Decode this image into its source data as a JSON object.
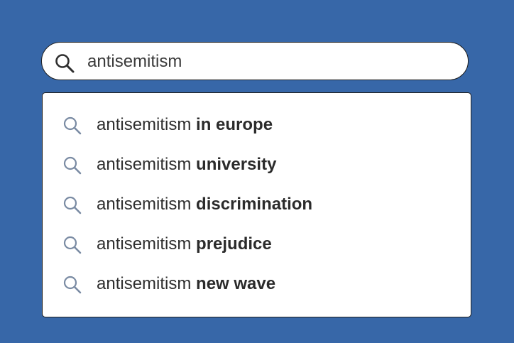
{
  "search": {
    "query": "antisemitism",
    "icon": "search-icon"
  },
  "suggestions": [
    {
      "base": "antisemitism ",
      "completion": "in europe",
      "icon": "search-icon"
    },
    {
      "base": "antisemitism ",
      "completion": "university",
      "icon": "search-icon"
    },
    {
      "base": "antisemitism ",
      "completion": "discrimination",
      "icon": "search-icon"
    },
    {
      "base": "antisemitism ",
      "completion": "prejudice",
      "icon": "search-icon"
    },
    {
      "base": "antisemitism ",
      "completion": "new wave",
      "icon": "search-icon"
    }
  ],
  "colors": {
    "background": "#3767a8",
    "search_icon_main": "#2f2f2f",
    "suggestion_icon": "#7a8ba3",
    "text": "#2e2e2e"
  }
}
